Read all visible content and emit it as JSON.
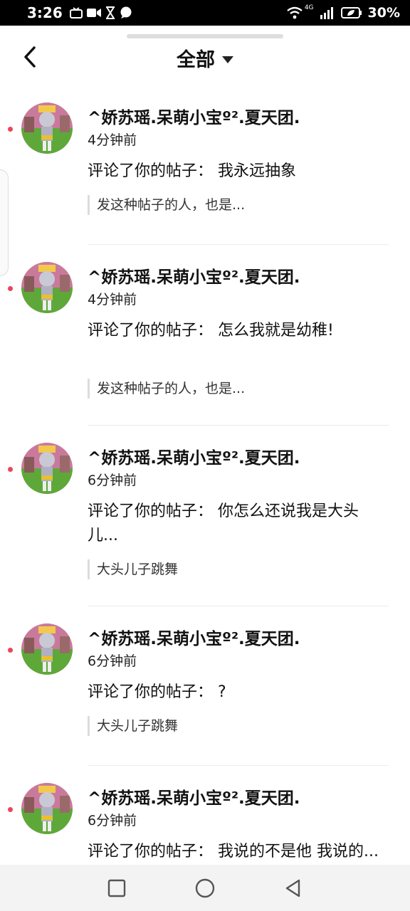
{
  "status_bar": {
    "time": "3:26",
    "network": "4G",
    "battery": "30%"
  },
  "header": {
    "title": "全部"
  },
  "notifications": [
    {
      "name": "^娇苏瑶.呆萌小宝º².夏天团.",
      "time": "4分钟前",
      "comment": "评论了你的帖子：  我永远抽象",
      "quote": "发这种帖子的人，也是..."
    },
    {
      "name": "^娇苏瑶.呆萌小宝º².夏天团.",
      "time": "4分钟前",
      "comment": "评论了你的帖子：  怎么我就是幼稚!",
      "quote": "发这种帖子的人，也是..."
    },
    {
      "name": "^娇苏瑶.呆萌小宝º².夏天团.",
      "time": "6分钟前",
      "comment": "评论了你的帖子：  你怎么还说我是大头儿...",
      "quote": "大头儿子跳舞"
    },
    {
      "name": "^娇苏瑶.呆萌小宝º².夏天团.",
      "time": "6分钟前",
      "comment": "评论了你的帖子：  ?",
      "quote": "大头儿子跳舞"
    },
    {
      "name": "^娇苏瑶.呆萌小宝º².夏天团.",
      "time": "6分钟前",
      "comment": "评论了你的帖子：  我说的不是他 我说的...",
      "quote": ""
    }
  ],
  "colors": {
    "unread_dot": "#f0435a",
    "divider": "#ececec",
    "nav_bar": "#f3f3f3"
  },
  "icons": {
    "back": "chevron-left-icon",
    "dropdown": "triangle-down-icon",
    "nav": [
      "square-icon",
      "circle-icon",
      "triangle-left-icon"
    ]
  }
}
